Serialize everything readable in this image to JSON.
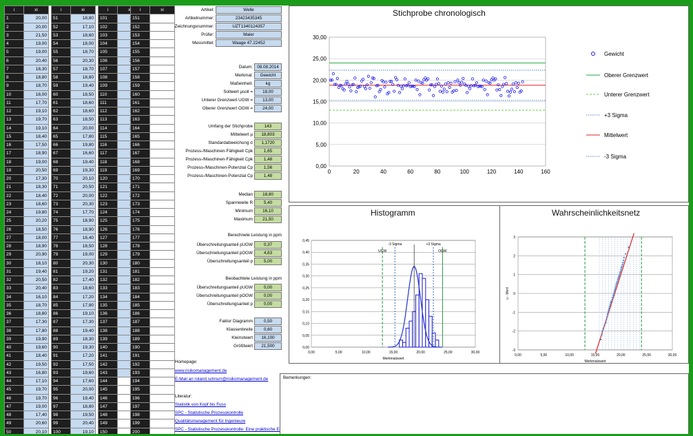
{
  "table_headers": {
    "i": "i",
    "xi": "xi"
  },
  "col1": [
    [
      "1",
      "20,00"
    ],
    [
      "2",
      "20,00"
    ],
    [
      "3",
      "21,50"
    ],
    [
      "4",
      "19,00"
    ],
    [
      "5",
      "19,00"
    ],
    [
      "6",
      "20,40"
    ],
    [
      "7",
      "18,30"
    ],
    [
      "8",
      "18,80"
    ],
    [
      "9",
      "18,70"
    ],
    [
      "10",
      "18,00"
    ],
    [
      "11",
      "17,70"
    ],
    [
      "12",
      "19,10"
    ],
    [
      "13",
      "19,70"
    ],
    [
      "14",
      "19,10"
    ],
    [
      "15",
      "18,40"
    ],
    [
      "16",
      "17,50"
    ],
    [
      "17",
      "18,90"
    ],
    [
      "18",
      "19,00"
    ],
    [
      "19",
      "20,50"
    ],
    [
      "20",
      "17,30"
    ],
    [
      "21",
      "18,30"
    ],
    [
      "22",
      "18,40"
    ],
    [
      "23",
      "18,60"
    ],
    [
      "24",
      "19,80"
    ],
    [
      "25",
      "20,20"
    ],
    [
      "26",
      "18,50"
    ],
    [
      "27",
      "18,00"
    ],
    [
      "28",
      "18,90"
    ],
    [
      "29",
      "20,90"
    ],
    [
      "30",
      "18,10"
    ],
    [
      "31",
      "19,40"
    ],
    [
      "32",
      "20,50"
    ],
    [
      "33",
      "20,40"
    ],
    [
      "34",
      "16,10"
    ],
    [
      "35",
      "18,70"
    ],
    [
      "36",
      "18,80"
    ],
    [
      "37",
      "17,30"
    ],
    [
      "38",
      "17,80"
    ],
    [
      "39",
      "19,90"
    ],
    [
      "40",
      "19,60"
    ],
    [
      "41",
      "18,40"
    ],
    [
      "42",
      "19,50"
    ],
    [
      "43",
      "16,80"
    ],
    [
      "44",
      "17,10"
    ],
    [
      "45",
      "19,70"
    ],
    [
      "46",
      "19,70"
    ],
    [
      "47",
      "19,00"
    ],
    [
      "48",
      "17,40"
    ],
    [
      "49",
      "20,60"
    ],
    [
      "50",
      "20,10"
    ]
  ],
  "col2": [
    [
      "51",
      "18,80"
    ],
    [
      "52",
      "17,10"
    ],
    [
      "53",
      "18,60"
    ],
    [
      "54",
      "18,00"
    ],
    [
      "55",
      "18,70"
    ],
    [
      "56",
      "20,30"
    ],
    [
      "57",
      "18,70"
    ],
    [
      "58",
      "18,80"
    ],
    [
      "59",
      "19,40"
    ],
    [
      "60",
      "18,50"
    ],
    [
      "61",
      "18,60"
    ],
    [
      "62",
      "18,60"
    ],
    [
      "63",
      "18,50"
    ],
    [
      "64",
      "20,00"
    ],
    [
      "65",
      "17,80"
    ],
    [
      "66",
      "19,80"
    ],
    [
      "67",
      "16,60"
    ],
    [
      "68",
      "19,40"
    ],
    [
      "69",
      "19,30"
    ],
    [
      "70",
      "20,10"
    ],
    [
      "71",
      "20,50"
    ],
    [
      "72",
      "20,00"
    ],
    [
      "73",
      "20,30"
    ],
    [
      "74",
      "17,70"
    ],
    [
      "75",
      "18,90"
    ],
    [
      "76",
      "18,90"
    ],
    [
      "77",
      "16,40"
    ],
    [
      "78",
      "18,50"
    ],
    [
      "79",
      "19,00"
    ],
    [
      "80",
      "20,30"
    ],
    [
      "81",
      "19,20"
    ],
    [
      "82",
      "17,40"
    ],
    [
      "83",
      "18,60"
    ],
    [
      "84",
      "17,20"
    ],
    [
      "85",
      "17,90"
    ],
    [
      "86",
      "19,10"
    ],
    [
      "87",
      "17,30"
    ],
    [
      "88",
      "19,40"
    ],
    [
      "89",
      "18,30"
    ],
    [
      "90",
      "19,30"
    ],
    [
      "91",
      "17,20"
    ],
    [
      "92",
      "17,50"
    ],
    [
      "93",
      "19,60"
    ],
    [
      "94",
      "17,60"
    ],
    [
      "95",
      "20,00"
    ],
    [
      "96",
      "19,40"
    ],
    [
      "97",
      "18,80"
    ],
    [
      "98",
      "19,50"
    ],
    [
      "99",
      "20,40"
    ],
    [
      "100",
      "19,10"
    ]
  ],
  "col3": [
    [
      "101",
      "18,80"
    ],
    [
      "102",
      "17,10"
    ],
    [
      "103",
      "18,60"
    ],
    [
      "104",
      "18,00"
    ],
    [
      "105",
      "18,70"
    ],
    [
      "106",
      "20,30"
    ],
    [
      "107",
      "18,70"
    ],
    [
      "108",
      "18,80"
    ],
    [
      "109",
      "19,40"
    ],
    [
      "110",
      "18,50"
    ],
    [
      "111",
      "18,60"
    ],
    [
      "112",
      "18,60"
    ],
    [
      "113",
      "18,50"
    ],
    [
      "114",
      "20,00"
    ],
    [
      "115",
      "17,80"
    ],
    [
      "116",
      "19,80"
    ],
    [
      "117",
      "16,60"
    ],
    [
      "118",
      "19,40"
    ],
    [
      "119",
      "19,30"
    ],
    [
      "120",
      "20,10"
    ],
    [
      "121",
      "20,50"
    ],
    [
      "122",
      "20,00"
    ],
    [
      "123",
      "20,30"
    ],
    [
      "124",
      "17,70"
    ],
    [
      "125",
      "18,90"
    ],
    [
      "126",
      "17,80"
    ],
    [
      "127",
      "16,40"
    ],
    [
      "128",
      "18,50"
    ],
    [
      "129",
      "19,00"
    ],
    [
      "130",
      "20,60"
    ],
    [
      "131",
      "19,20"
    ],
    [
      "132",
      "17,40"
    ],
    [
      "133",
      "16,30"
    ],
    [
      "134",
      "17,20"
    ],
    [
      "135",
      "17,90"
    ],
    [
      "136",
      "19,10"
    ],
    [
      "137",
      "17,30"
    ],
    [
      "138",
      "19,40"
    ],
    [
      "139",
      "18,30"
    ],
    [
      "140",
      "19,30"
    ],
    [
      "141",
      "17,20"
    ],
    [
      "142",
      "17,50"
    ],
    [
      "143",
      "19,60"
    ],
    [
      "144",
      ""
    ],
    [
      "145",
      ""
    ],
    [
      "146",
      ""
    ],
    [
      "147",
      ""
    ],
    [
      "148",
      ""
    ],
    [
      "149",
      ""
    ],
    [
      "150",
      ""
    ]
  ],
  "col4": [
    "151",
    "152",
    "153",
    "154",
    "155",
    "156",
    "157",
    "158",
    "159",
    "160",
    "161",
    "162",
    "163",
    "164",
    "165",
    "166",
    "167",
    "168",
    "169",
    "170",
    "171",
    "172",
    "173",
    "174",
    "175",
    "176",
    "177",
    "178",
    "179",
    "180",
    "181",
    "182",
    "183",
    "184",
    "185",
    "186",
    "187",
    "188",
    "189",
    "190",
    "191",
    "192",
    "193",
    "194",
    "195",
    "196",
    "197",
    "198",
    "199",
    "200"
  ],
  "info": [
    {
      "label": "Artikel:",
      "value": "Welle"
    },
    {
      "label": "Artikelnummer:",
      "value": "23423435345"
    },
    {
      "label": "Zeichnungsnummer:",
      "value": "UZT1340124357"
    },
    {
      "label": "Prüfer:",
      "value": "Maier"
    },
    {
      "label": "Messmittel:",
      "value": "Waage 47.22452"
    }
  ],
  "spec": [
    {
      "label": "Datum:",
      "value": "08.08.2014"
    },
    {
      "label": "Merkmal:",
      "value": "Gewicht"
    },
    {
      "label": "Maßeinheit:",
      "value": "kg"
    },
    {
      "label": "Sollwert µsoll =",
      "value": "18,00"
    },
    {
      "label": "Unterer Grenzwert UGW =",
      "value": "13,00"
    },
    {
      "label": "Oberer Grenzwert OGW =",
      "value": "24,00"
    }
  ],
  "stats": [
    {
      "label": "Umfang der Stichprobe",
      "value": "143"
    },
    {
      "label": "Mittelwert µ",
      "value": "18,803"
    },
    {
      "label": "Standardabweichung σ",
      "value": "1,1720"
    },
    {
      "label": "Prozess-/Maschinen-Fähigkeit Cpk",
      "value": "1,65"
    },
    {
      "label": "Prozess-/Maschinen-Fähigkeit Cpk",
      "value": "1,48"
    },
    {
      "label": "Prozess-/Maschinen-Potenzial Cp",
      "value": "1,56"
    },
    {
      "label": "Prozess-/Maschinen-Potenzial Cp",
      "value": "1,48"
    }
  ],
  "stats2": [
    {
      "label": "Median",
      "value": "18,80"
    },
    {
      "label": "Spannweite R",
      "value": "5,40"
    },
    {
      "label": "Minimum",
      "value": "16,10"
    },
    {
      "label": "Maximum",
      "value": "21,50"
    }
  ],
  "ppm_calc_title": "Berechnete Leistung in ppm",
  "ppm_calc": [
    {
      "label": "Überschreitungsanteil pUGW",
      "value": "0,37"
    },
    {
      "label": "Überschreitungsanteil pOGW",
      "value": "4,63"
    },
    {
      "label": "Überschreitungsanteil p",
      "value": "5,00"
    }
  ],
  "ppm_obs_title": "Beobachtete Leistung in ppm",
  "ppm_obs": [
    {
      "label": "Überschreitungsanteil pUGW",
      "value": "0,00"
    },
    {
      "label": "Überschreitungsanteil pOGW",
      "value": "0,00"
    },
    {
      "label": "Überschreitungsanteil p",
      "value": "0,00"
    }
  ],
  "diagram": [
    {
      "label": "Faktor Diagramm",
      "value": "0,50"
    },
    {
      "label": "Klassenbreite",
      "value": "0,60"
    },
    {
      "label": "Kleinstwert",
      "value": "16,100"
    },
    {
      "label": "Größtwert",
      "value": "21,500"
    }
  ],
  "homepage_label": "Homepage:",
  "homepage_link": "www.risikomanagement.de",
  "email_link": "E-Mail an roland.schnurr@risikomanagement.de",
  "remarks_label": "Bemerkungen:",
  "literature_label": "Literatur:",
  "literature": [
    "Statistik von Kopf bis Fuss",
    "SPC - Statistische Prozesskontrolle",
    "Qualitätsmanagement für Ingenieure",
    "SPC - Statistische Prozesskontrolle: Eine praktische Einführung in die statistische Prozesskontrolle"
  ],
  "chart_data": [
    {
      "type": "scatter",
      "title": "Stichprobe chronologisch",
      "xlim": [
        0,
        160
      ],
      "ylim": [
        0,
        30
      ],
      "x_ticks": [
        "0",
        "20",
        "40",
        "60",
        "80",
        "100",
        "120",
        "140",
        "160"
      ],
      "y_ticks": [
        "0,00",
        "5,00",
        "10,00",
        "15,00",
        "20,00",
        "25,00",
        "30,00"
      ],
      "legend": [
        "Gewicht",
        "Oberer Grenzwert",
        "Unterer Grenzwert",
        "+3 Sigma",
        "Mittelwert",
        "-3 Sigma"
      ],
      "legend_position": "right",
      "series": [
        {
          "name": "Gewicht",
          "color": "#1a1aee",
          "values": [
            20.0,
            20.0,
            21.5,
            19.0,
            19.0,
            20.4,
            18.3,
            18.8,
            18.7,
            18.0,
            17.7,
            19.1,
            19.7,
            19.1,
            18.4,
            17.5,
            18.9,
            19.0,
            20.5,
            17.3,
            18.3,
            18.4,
            18.6,
            19.8,
            20.2,
            18.5,
            18.0,
            18.9,
            20.9,
            18.1,
            19.4,
            20.5,
            20.4,
            16.1,
            18.7,
            18.8,
            17.3,
            17.8,
            19.9,
            19.6,
            18.4,
            19.5,
            16.8,
            17.1,
            19.7,
            19.7,
            19.0,
            17.4,
            20.6,
            20.1,
            18.8,
            17.1,
            18.6,
            18.0,
            18.7,
            20.3,
            18.7,
            18.8,
            19.4,
            18.5,
            18.6,
            18.6,
            18.5,
            20.0,
            17.8,
            19.8,
            16.6,
            19.4,
            19.3,
            20.1,
            20.5,
            20.0,
            20.3,
            17.7,
            18.9,
            18.9,
            16.4,
            18.5,
            19.0,
            20.3,
            19.2,
            17.4,
            18.6,
            17.2,
            17.9,
            19.1,
            17.3,
            19.4,
            18.3,
            19.3,
            17.2,
            17.5,
            19.6,
            17.6,
            20.0,
            19.4,
            18.8,
            19.5,
            20.4,
            19.1,
            18.8,
            17.1,
            18.6,
            18.0,
            18.7,
            20.3,
            18.7,
            18.8,
            19.4,
            18.5,
            18.6,
            18.6,
            18.5,
            20.0,
            17.8,
            19.8,
            16.6,
            19.4,
            19.3,
            20.1,
            20.5,
            20.0,
            20.3,
            17.7,
            18.9,
            17.8,
            16.4,
            18.5,
            19.0,
            20.6,
            19.2,
            17.4,
            16.3,
            17.2,
            17.9,
            19.1,
            17.3,
            19.4,
            18.3,
            19.3,
            17.2,
            17.5,
            19.6
          ]
        },
        {
          "name": "Oberer Grenzwert",
          "color": "#22aa44",
          "value": 24.0
        },
        {
          "name": "Unterer Grenzwert",
          "color": "#66cc44",
          "value": 13.0
        },
        {
          "name": "+3 Sigma",
          "color": "#4488dd",
          "value": 22.32
        },
        {
          "name": "Mittelwert",
          "color": "#dd2222",
          "value": 18.803
        },
        {
          "name": "-3 Sigma",
          "color": "#4488dd",
          "value": 15.29
        }
      ]
    },
    {
      "type": "bar",
      "title": "Histogramm",
      "xlabel": "Merkmalswert",
      "xlim": [
        0,
        30
      ],
      "ylim": [
        0,
        0.45
      ],
      "x_ticks": [
        "0,00",
        "5,00",
        "10,00",
        "15,00",
        "20,00",
        "25,00",
        "30,00"
      ],
      "y_ticks": [
        "0,00",
        "0,05",
        "0,10",
        "0,15",
        "0,20",
        "0,25",
        "0,30",
        "0,35",
        "0,40",
        "0,45"
      ],
      "annotations": [
        "-3 Sigma",
        "+3 Sigma",
        "UGW",
        "OGW"
      ],
      "bin_start": 16.1,
      "bin_width": 0.6,
      "values": [
        0.03,
        0.02,
        0.08,
        0.11,
        0.15,
        0.22,
        0.31,
        0.29,
        0.2,
        0.13,
        0.06,
        0.03
      ],
      "density_line_color": "#2233cc",
      "mean": 18.803,
      "sigma": 1.172,
      "limits": {
        "UGW": 13.0,
        "OGW": 24.0,
        "minus3sigma": 15.29,
        "plus3sigma": 22.32
      }
    },
    {
      "type": "scatter",
      "title": "Wahrscheinlichkeitsnetz",
      "xlabel": "Merkmalswert",
      "ylabel": "u - Wert",
      "xlim": [
        0,
        30
      ],
      "ylim": [
        -3,
        3
      ],
      "x_ticks": [
        "0,00",
        "5,00",
        "10,00",
        "15,00",
        "20,00",
        "25,00",
        "30,00"
      ],
      "y_ticks": [
        "-3",
        "-2",
        "-1",
        "0",
        "1",
        "2",
        "3"
      ],
      "points_x": [
        16.1,
        16.3,
        16.4,
        16.6,
        16.8,
        17.1,
        17.2,
        17.3,
        17.4,
        17.5,
        17.6,
        17.7,
        17.8,
        17.9,
        18.0,
        18.1,
        18.3,
        18.4,
        18.5,
        18.6,
        18.7,
        18.8,
        18.9,
        19.0,
        19.1,
        19.2,
        19.3,
        19.4,
        19.5,
        19.6,
        19.7,
        19.8,
        19.9,
        20.0,
        20.1,
        20.2,
        20.3,
        20.4,
        20.5,
        20.6,
        20.9,
        21.5
      ],
      "points_u": [
        -2.45,
        -2.2,
        -2.0,
        -1.85,
        -1.7,
        -1.55,
        -1.4,
        -1.25,
        -1.1,
        -1.0,
        -0.9,
        -0.8,
        -0.7,
        -0.6,
        -0.5,
        -0.42,
        -0.32,
        -0.22,
        -0.12,
        -0.02,
        0.08,
        0.18,
        0.28,
        0.38,
        0.48,
        0.56,
        0.64,
        0.74,
        0.82,
        0.9,
        0.98,
        1.08,
        1.16,
        1.26,
        1.36,
        1.44,
        1.54,
        1.64,
        1.76,
        1.9,
        2.1,
        2.45
      ],
      "fit_color": "#dd2222",
      "points_color": "#4488dd"
    }
  ]
}
